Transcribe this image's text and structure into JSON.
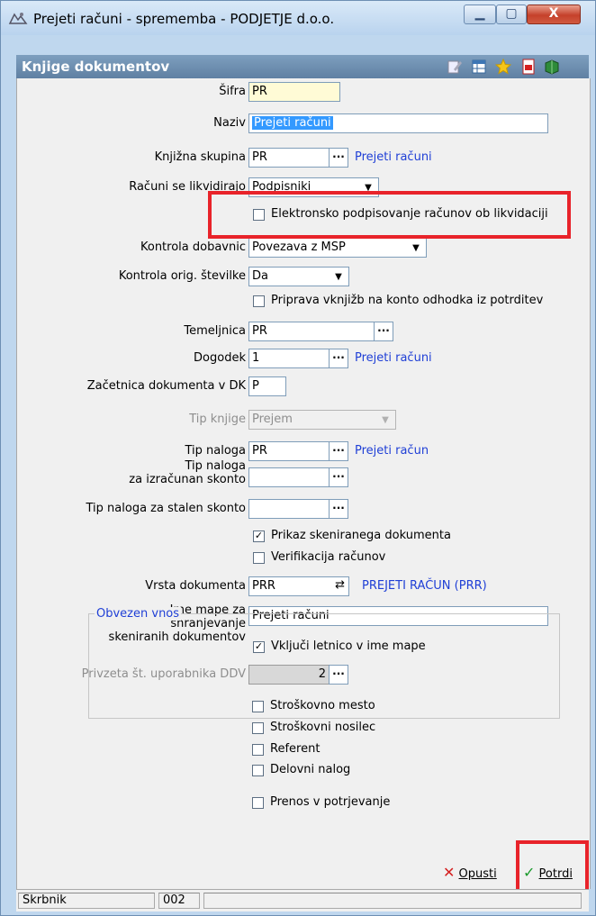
{
  "window": {
    "title": "Prejeti računi - sprememba - PODJETJE d.o.o.",
    "min_glyph": "▁",
    "max_glyph": "▢",
    "close_glyph": "X"
  },
  "panel": {
    "title": "Knjige dokumentov"
  },
  "toolbar_icons": [
    "edit-icon",
    "grid-icon",
    "star-icon",
    "pdf-icon",
    "book-icon"
  ],
  "form": {
    "sifra": {
      "label": "Šifra",
      "value": "PR"
    },
    "naziv": {
      "label": "Naziv",
      "value": "Prejeti računi"
    },
    "knjizna_skupina": {
      "label": "Knjižna skupina",
      "value": "PR",
      "link": "Prejeti računi"
    },
    "racuni_likvidirajo": {
      "label": "Računi se likvidirajo",
      "value": "Podpisniki"
    },
    "elektronsko": {
      "label": "Elektronsko podpisovanje računov ob likvidaciji",
      "checked": false
    },
    "kontrola_dobavnic": {
      "label": "Kontrola dobavnic",
      "value": "Povezava z MSP"
    },
    "kontrola_stevilke": {
      "label": "Kontrola orig. številke",
      "value": "Da"
    },
    "priprava": {
      "label": "Priprava vknjižb na konto odhodka iz potrditev",
      "checked": false
    },
    "temeljnica": {
      "label": "Temeljnica",
      "value": "PR"
    },
    "dogodek": {
      "label": "Dogodek",
      "value": "1",
      "link": "Prejeti računi"
    },
    "zacetnica": {
      "label": "Začetnica dokumenta v DK",
      "value": "P"
    },
    "tip_knjige": {
      "label": "Tip knjige",
      "value": "Prejem"
    },
    "tip_naloga": {
      "label": "Tip naloga",
      "value": "PR",
      "link": "Prejeti račun"
    },
    "tip_naloga_izracunan": {
      "label_line1": "Tip naloga",
      "label_line2": "za izračunan skonto",
      "value": ""
    },
    "tip_naloga_stalen": {
      "label": "Tip naloga za stalen skonto",
      "value": ""
    },
    "prikaz": {
      "label": "Prikaz skeniranega dokumenta",
      "checked": true
    },
    "verifikacija": {
      "label": "Verifikacija računov",
      "checked": false
    },
    "vrsta_dokumenta": {
      "label": "Vrsta dokumenta",
      "value": "PRR",
      "link": "PREJETI RAČUN (PRR)"
    },
    "ime_mape": {
      "label_line1": "Ime mape za",
      "label_line2": "shranjevanje",
      "label_line3": "skeniranih dokumentov",
      "value": "Prejeti računi"
    },
    "vkljuci_letnico": {
      "label": "Vključi letnico v ime mape",
      "checked": true
    },
    "privzeta": {
      "label": "Privzeta št. uporabnika DDV",
      "value": "2"
    }
  },
  "obvezen_vnos": {
    "title": "Obvezen vnos",
    "items": [
      {
        "label": "Stroškovno mesto",
        "checked": false
      },
      {
        "label": "Stroškovni nosilec",
        "checked": false
      },
      {
        "label": "Referent",
        "checked": false
      },
      {
        "label": "Delovni nalog",
        "checked": false
      }
    ]
  },
  "prenos": {
    "label": "Prenos v potrjevanje",
    "checked": false
  },
  "buttons": {
    "cancel": "Opusti",
    "confirm": "Potrdi"
  },
  "statusbar": {
    "user": "Skrbnik",
    "code": "002"
  },
  "colors": {
    "highlight": "#e8232a",
    "link": "#1f3fd6",
    "selection": "#3399ff"
  }
}
